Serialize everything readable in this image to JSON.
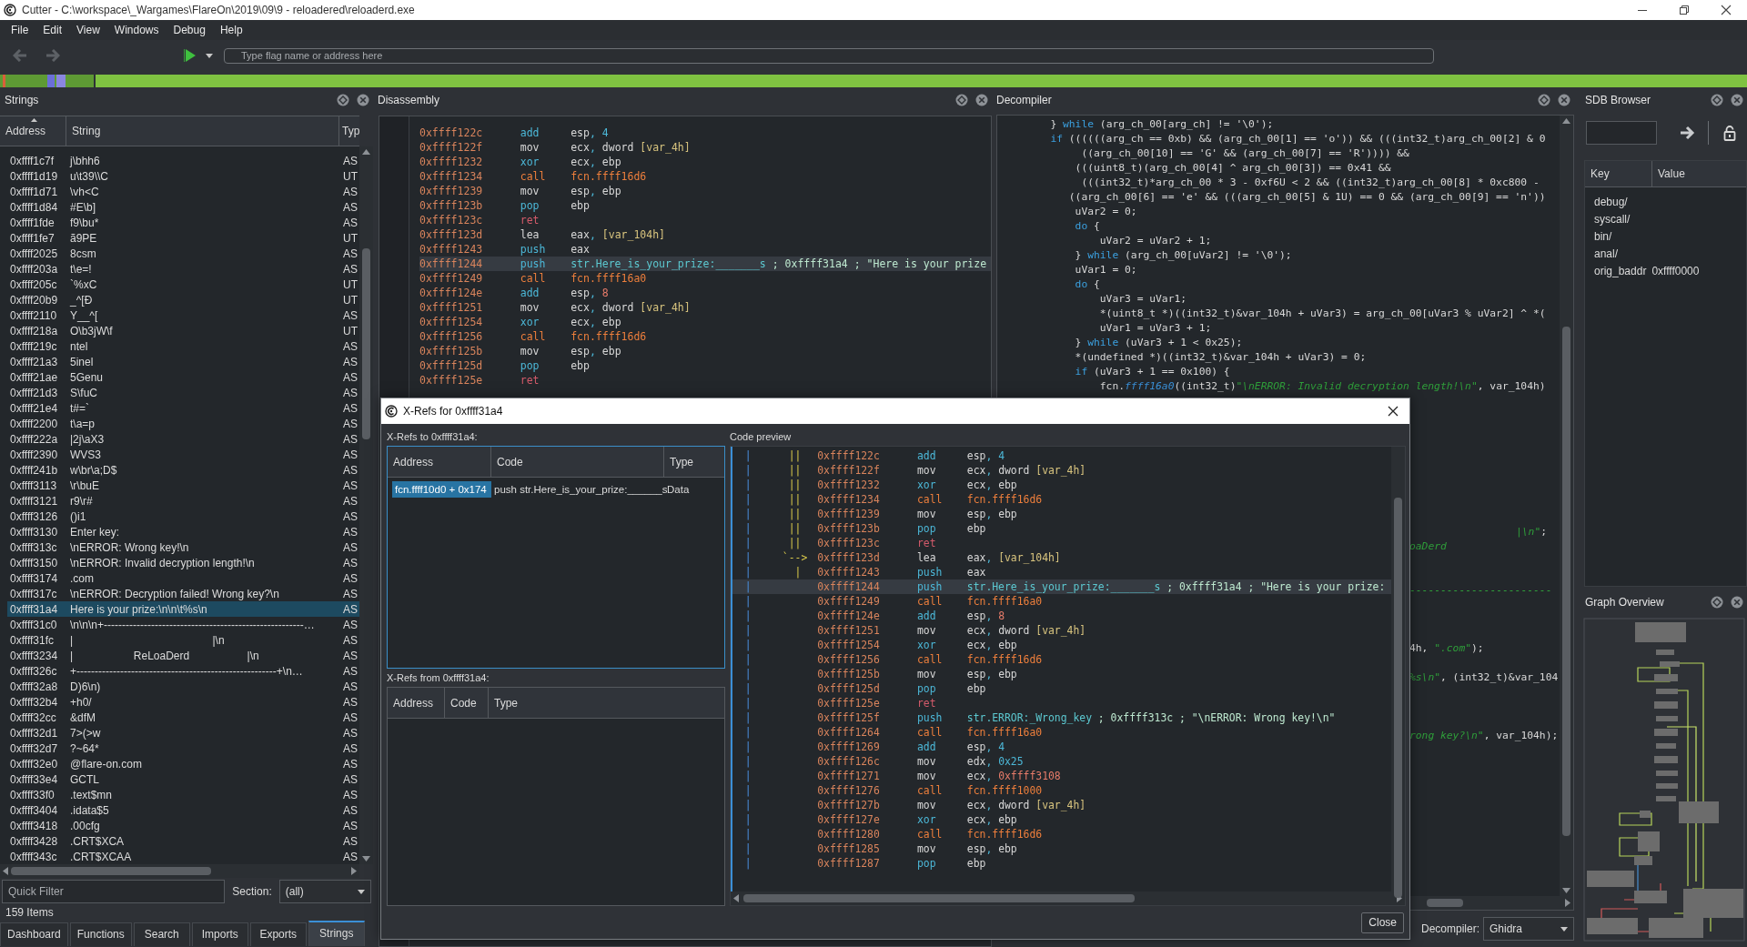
{
  "window": {
    "title": "Cutter - C:\\workspace\\_Wargames\\FlareOn\\2019\\09\\9 - reloadered\\reloaderd.exe"
  },
  "menu": [
    "File",
    "Edit",
    "View",
    "Windows",
    "Debug",
    "Help"
  ],
  "toolbar": {
    "search": {
      "placeholder": "Type flag name or address here"
    }
  },
  "strings_panel": {
    "title": "Strings",
    "columns": [
      "Address",
      "String",
      "Typ"
    ],
    "rows": [
      {
        "address": "0xffff1c7f",
        "string": "j\\bhh6",
        "type": "AS",
        "selected": false
      },
      {
        "address": "0xffff1d19",
        "string": "u\\t39\\\\C",
        "type": "UT",
        "selected": false
      },
      {
        "address": "0xffff1d71",
        "string": "\\vh<C",
        "type": "AS",
        "selected": false
      },
      {
        "address": "0xffff1d84",
        "string": "#E\\b]",
        "type": "AS",
        "selected": false
      },
      {
        "address": "0xffff1fde",
        "string": "f9\\bu*",
        "type": "AS",
        "selected": false
      },
      {
        "address": "0xffff1fe7",
        "string": "ã9PE",
        "type": "UT",
        "selected": false
      },
      {
        "address": "0xffff2025",
        "string": "8csm",
        "type": "AS",
        "selected": false
      },
      {
        "address": "0xffff203a",
        "string": "t\\e=!",
        "type": "AS",
        "selected": false
      },
      {
        "address": "0xffff205c",
        "string": "`%xC",
        "type": "UT",
        "selected": false
      },
      {
        "address": "0xffff20b9",
        "string": "_^[Ð",
        "type": "UT",
        "selected": false
      },
      {
        "address": "0xffff2110",
        "string": "Y__^[",
        "type": "AS",
        "selected": false
      },
      {
        "address": "0xffff218a",
        "string": "O\\b3jW\\f",
        "type": "UT",
        "selected": false
      },
      {
        "address": "0xffff219c",
        "string": "ntel",
        "type": "AS",
        "selected": false
      },
      {
        "address": "0xffff21a3",
        "string": "5inel",
        "type": "AS",
        "selected": false
      },
      {
        "address": "0xffff21ae",
        "string": "5Genu",
        "type": "AS",
        "selected": false
      },
      {
        "address": "0xffff21d3",
        "string": "S\\fuC",
        "type": "AS",
        "selected": false
      },
      {
        "address": "0xffff21e4",
        "string": "t#=`",
        "type": "AS",
        "selected": false
      },
      {
        "address": "0xffff2200",
        "string": "t\\a=p",
        "type": "AS",
        "selected": false
      },
      {
        "address": "0xffff222a",
        "string": "|2j\\aX3",
        "type": "AS",
        "selected": false
      },
      {
        "address": "0xffff2390",
        "string": "WVS3",
        "type": "AS",
        "selected": false
      },
      {
        "address": "0xffff241b",
        "string": "w\\br\\a;D$",
        "type": "AS",
        "selected": false
      },
      {
        "address": "0xffff3113",
        "string": "\\r\\buE",
        "type": "AS",
        "selected": false
      },
      {
        "address": "0xffff3121",
        "string": "r9\\r#",
        "type": "AS",
        "selected": false
      },
      {
        "address": "0xffff3126",
        "string": "()i1",
        "type": "AS",
        "selected": false
      },
      {
        "address": "0xffff3130",
        "string": "Enter key:",
        "type": "AS",
        "selected": false
      },
      {
        "address": "0xffff313c",
        "string": "\\nERROR: Wrong key!\\n",
        "type": "AS",
        "selected": false
      },
      {
        "address": "0xffff3150",
        "string": "\\nERROR: Invalid decryption length!\\n",
        "type": "AS",
        "selected": false
      },
      {
        "address": "0xffff3174",
        "string": ".com",
        "type": "AS",
        "selected": false
      },
      {
        "address": "0xffff317c",
        "string": "\\nERROR: Decryption failed! Wrong key?\\n",
        "type": "AS",
        "selected": false
      },
      {
        "address": "0xffff31a4",
        "string": "Here is your prize:\\n\\n\\t%s\\n",
        "type": "AS",
        "selected": true
      },
      {
        "address": "0xffff31c0",
        "string": "\\n\\n\\n+-------------------------------------------------------…",
        "type": "AS",
        "selected": false
      },
      {
        "address": "0xffff31fc",
        "string": "|                                              |\\n",
        "type": "AS",
        "selected": false
      },
      {
        "address": "0xffff3234",
        "string": "|                    ReLoaDerd                   |\\n",
        "type": "AS",
        "selected": false
      },
      {
        "address": "0xffff326c",
        "string": "+-------------------------------------------------------+\\n…",
        "type": "AS",
        "selected": false
      },
      {
        "address": "0xffff32a8",
        "string": "D)6\\n)",
        "type": "AS",
        "selected": false
      },
      {
        "address": "0xffff32b4",
        "string": "+h0/",
        "type": "AS",
        "selected": false
      },
      {
        "address": "0xffff32cc",
        "string": "&dfM",
        "type": "AS",
        "selected": false
      },
      {
        "address": "0xffff32d1",
        "string": "7>(>w",
        "type": "AS",
        "selected": false
      },
      {
        "address": "0xffff32d7",
        "string": "?~64*",
        "type": "AS",
        "selected": false
      },
      {
        "address": "0xffff32e0",
        "string": "@flare-on.com",
        "type": "AS",
        "selected": false
      },
      {
        "address": "0xffff33e4",
        "string": "GCTL",
        "type": "AS",
        "selected": false
      },
      {
        "address": "0xffff33f0",
        "string": ".text$mn",
        "type": "AS",
        "selected": false
      },
      {
        "address": "0xffff3404",
        "string": ".idata$5",
        "type": "AS",
        "selected": false
      },
      {
        "address": "0xffff3418",
        "string": ".00cfg",
        "type": "AS",
        "selected": false
      },
      {
        "address": "0xffff3428",
        "string": ".CRT$XCA",
        "type": "AS",
        "selected": false
      },
      {
        "address": "0xffff343c",
        "string": ".CRT$XCAA",
        "type": "AS",
        "selected": false
      }
    ],
    "filter": {
      "placeholder": "Quick Filter"
    },
    "section_label": "Section:",
    "section_value": "(all)",
    "count": "159 Items"
  },
  "bottom_tabs": [
    {
      "label": "Dashboard",
      "selected": false
    },
    {
      "label": "Functions",
      "selected": false
    },
    {
      "label": "Search",
      "selected": false
    },
    {
      "label": "Imports",
      "selected": false
    },
    {
      "label": "Exports",
      "selected": false
    },
    {
      "label": "Strings",
      "selected": true
    }
  ],
  "disassembly": {
    "title": "Disassembly",
    "rows": [
      {
        "address": "0xffff122c",
        "mnemonic": "add",
        "kind": "arith",
        "operands": [
          {
            "text": "esp",
            "kind": "reg"
          },
          {
            "text": ", ",
            "kind": "punct"
          },
          {
            "text": "4",
            "kind": "num"
          }
        ],
        "selected": false
      },
      {
        "address": "0xffff122f",
        "mnemonic": "mov",
        "kind": "move",
        "operands": [
          {
            "text": "ecx",
            "kind": "reg"
          },
          {
            "text": ", ",
            "kind": "punct"
          },
          {
            "text": "dword ",
            "kind": "reg"
          },
          {
            "text": "[var_4h]",
            "kind": "var"
          }
        ],
        "selected": false
      },
      {
        "address": "0xffff1232",
        "mnemonic": "xor",
        "kind": "arith",
        "operands": [
          {
            "text": "ecx",
            "kind": "reg"
          },
          {
            "text": ", ",
            "kind": "punct"
          },
          {
            "text": "ebp",
            "kind": "reg"
          }
        ],
        "selected": false
      },
      {
        "address": "0xffff1234",
        "mnemonic": "call",
        "kind": "call",
        "operands": [
          {
            "text": "fcn.ffff16d6",
            "kind": "fcn"
          }
        ],
        "selected": false
      },
      {
        "address": "0xffff1239",
        "mnemonic": "mov",
        "kind": "move",
        "operands": [
          {
            "text": "esp",
            "kind": "reg"
          },
          {
            "text": ", ",
            "kind": "punct"
          },
          {
            "text": "ebp",
            "kind": "reg"
          }
        ],
        "selected": false
      },
      {
        "address": "0xffff123b",
        "mnemonic": "pop",
        "kind": "arith",
        "operands": [
          {
            "text": "ebp",
            "kind": "reg"
          }
        ],
        "selected": false
      },
      {
        "address": "0xffff123c",
        "mnemonic": "ret",
        "kind": "ret",
        "operands": [],
        "selected": false
      },
      {
        "address": "0xffff123d",
        "mnemonic": "lea",
        "kind": "move",
        "operands": [
          {
            "text": "eax",
            "kind": "reg"
          },
          {
            "text": ", ",
            "kind": "punct"
          },
          {
            "text": "[var_104h]",
            "kind": "var"
          }
        ],
        "selected": false
      },
      {
        "address": "0xffff1243",
        "mnemonic": "push",
        "kind": "arith",
        "operands": [
          {
            "text": "eax",
            "kind": "reg"
          }
        ],
        "selected": false
      },
      {
        "address": "0xffff1244",
        "mnemonic": "push",
        "kind": "arith",
        "operands": [
          {
            "text": "str.Here_is_your_prize:_______s",
            "kind": "str"
          },
          {
            "text": " ; 0xffff31a4 ; \"Here is your prize",
            "kind": "comment"
          }
        ],
        "selected": true
      },
      {
        "address": "0xffff1249",
        "mnemonic": "call",
        "kind": "call",
        "operands": [
          {
            "text": "fcn.ffff16a0",
            "kind": "fcn"
          }
        ],
        "selected": false
      },
      {
        "address": "0xffff124e",
        "mnemonic": "add",
        "kind": "arith",
        "operands": [
          {
            "text": "esp",
            "kind": "reg"
          },
          {
            "text": ", ",
            "kind": "punct"
          },
          {
            "text": "8",
            "kind": "numalt"
          }
        ],
        "selected": false
      },
      {
        "address": "0xffff1251",
        "mnemonic": "mov",
        "kind": "move",
        "operands": [
          {
            "text": "ecx",
            "kind": "reg"
          },
          {
            "text": ", ",
            "kind": "punct"
          },
          {
            "text": "dword ",
            "kind": "reg"
          },
          {
            "text": "[var_4h]",
            "kind": "var"
          }
        ],
        "selected": false
      },
      {
        "address": "0xffff1254",
        "mnemonic": "xor",
        "kind": "arith",
        "operands": [
          {
            "text": "ecx",
            "kind": "reg"
          },
          {
            "text": ", ",
            "kind": "punct"
          },
          {
            "text": "ebp",
            "kind": "reg"
          }
        ],
        "selected": false
      },
      {
        "address": "0xffff1256",
        "mnemonic": "call",
        "kind": "call",
        "operands": [
          {
            "text": "fcn.ffff16d6",
            "kind": "fcn"
          }
        ],
        "selected": false
      },
      {
        "address": "0xffff125b",
        "mnemonic": "mov",
        "kind": "move",
        "operands": [
          {
            "text": "esp",
            "kind": "reg"
          },
          {
            "text": ", ",
            "kind": "punct"
          },
          {
            "text": "ebp",
            "kind": "reg"
          }
        ],
        "selected": false
      },
      {
        "address": "0xffff125d",
        "mnemonic": "pop",
        "kind": "arith",
        "operands": [
          {
            "text": "ebp",
            "kind": "reg"
          }
        ],
        "selected": false
      },
      {
        "address": "0xffff125e",
        "mnemonic": "ret",
        "kind": "ret",
        "operands": [],
        "selected": false
      }
    ]
  },
  "decompiler": {
    "title": "Decompiler",
    "lines": [
      [
        {
          "text": "        } ",
          "kind": "plain"
        },
        {
          "text": "while",
          "kind": "kw"
        },
        {
          "text": " (arg_ch_00[arg_ch] != '\\0');",
          "kind": "plain"
        }
      ],
      [
        {
          "text": "        if",
          "kind": "kw"
        },
        {
          "text": " ((((((arg_ch == 0xb) && (arg_ch_00[1] == 'o')) && (((int32_t)arg_ch_00[2] & 0",
          "kind": "plain"
        }
      ],
      [
        {
          "text": "             ((arg_ch_00[10] == 'G' && (arg_ch_00[7] == 'R')))) &&",
          "kind": "plain"
        }
      ],
      [
        {
          "text": "            (((uint8_t)(arg_ch_00[4] ^ arg_ch_00[3]) == 0x41 &&",
          "kind": "plain"
        }
      ],
      [
        {
          "text": "             (((int32_t)*arg_ch_00 * 3 - 0xf6U < 2 && ((int32_t)arg_ch_00[8] * 0xc800 -",
          "kind": "plain"
        }
      ],
      [
        {
          "text": "           ((arg_ch_00[6] == 'e' && (((arg_ch_00[5] & 1U) == 0 && (arg_ch_00[9] == 'n'))",
          "kind": "plain"
        }
      ],
      [
        {
          "text": "            uVar2 = 0;",
          "kind": "plain"
        }
      ],
      [
        {
          "text": "            do",
          "kind": "kw"
        },
        {
          "text": " {",
          "kind": "plain"
        }
      ],
      [
        {
          "text": "                uVar2 = uVar2 + 1;",
          "kind": "plain"
        }
      ],
      [
        {
          "text": "            } ",
          "kind": "plain"
        },
        {
          "text": "while",
          "kind": "kw"
        },
        {
          "text": " (arg_ch_00[uVar2] != '\\0');",
          "kind": "plain"
        }
      ],
      [
        {
          "text": "            uVar1 = 0;",
          "kind": "plain"
        }
      ],
      [
        {
          "text": "            do",
          "kind": "kw"
        },
        {
          "text": " {",
          "kind": "plain"
        }
      ],
      [
        {
          "text": "                uVar3 = uVar1;",
          "kind": "plain"
        }
      ],
      [
        {
          "text": "                *(uint8_t *)((int32_t)&var_104h + uVar3) = arg_ch_00[uVar3 % uVar2] ^ *(",
          "kind": "plain"
        }
      ],
      [
        {
          "text": "                uVar1 = uVar3 + 1;",
          "kind": "plain"
        }
      ],
      [
        {
          "text": "            } ",
          "kind": "plain"
        },
        {
          "text": "while",
          "kind": "kw"
        },
        {
          "text": " (uVar3 + 1 < 0x25);",
          "kind": "plain"
        }
      ],
      [
        {
          "text": "            *(undefined *)((int32_t)&var_104h + uVar3) = 0;",
          "kind": "plain"
        }
      ],
      [
        {
          "text": "            if",
          "kind": "kw"
        },
        {
          "text": " (uVar3 + 1 == 0x100) {",
          "kind": "plain"
        }
      ],
      [
        {
          "text": "                fcn.",
          "kind": "plain"
        },
        {
          "text": "ffff16a0",
          "kind": "fn"
        },
        {
          "text": "((int32_t)",
          "kind": "plain"
        },
        {
          "text": "\"\\nERROR: Invalid decryption length!\\n\"",
          "kind": "str"
        },
        {
          "text": ", var_104h)",
          "kind": "plain"
        }
      ]
    ],
    "visible_fragments": [
      [
        {
          "text": "|\\n\"",
          "kind": "str"
        },
        {
          "text": ";",
          "kind": "plain"
        }
      ],
      [
        {
          "text": "oaDerd",
          "kind": "str"
        }
      ],
      [
        {
          "text": "-----------------------",
          "kind": "str"
        }
      ],
      [
        {
          "text": "4h, ",
          "kind": "plain"
        },
        {
          "text": "\".com\"",
          "kind": "str"
        },
        {
          "text": ");",
          "kind": "plain"
        }
      ],
      [
        {
          "text": "%s\\n\"",
          "kind": "str"
        },
        {
          "text": ", (int32_t)&var_104",
          "kind": "plain"
        }
      ],
      [
        {
          "text": "rong key?\\n\"",
          "kind": "str"
        },
        {
          "text": ", var_104h);",
          "kind": "plain"
        }
      ]
    ],
    "engine_label": "Decompiler:",
    "engine": "Ghidra"
  },
  "sdb_browser": {
    "title": "SDB Browser",
    "columns": [
      "Key",
      "Value"
    ],
    "rows": [
      {
        "key": "debug/"
      },
      {
        "key": "syscall/"
      },
      {
        "key": "bin/"
      },
      {
        "key": "anal/"
      },
      {
        "key": "orig_baddr",
        "value": "0xffff0000"
      }
    ]
  },
  "graph_overview": {
    "title": "Graph Overview"
  },
  "xrefs_dialog": {
    "title": "X-Refs for 0xffff31a4",
    "to_label": "X-Refs to 0xffff31a4:",
    "to_columns": [
      "Address",
      "Code",
      "Type"
    ],
    "to_rows": [
      {
        "address": "fcn.ffff10d0 + 0x174",
        "code": "push str.Here_is_your_prize:______s",
        "type": "Data",
        "selected": true
      }
    ],
    "from_label": "X-Refs from 0xffff31a4:",
    "from_columns": [
      "Address",
      "Code",
      "Type"
    ],
    "preview_label": "Code preview",
    "preview_rows": [
      {
        "rail": "|",
        "branch": "      ||",
        "address": "0xffff122c",
        "mnemonic": "add",
        "kind": "arith",
        "operands": [
          {
            "text": "esp",
            "kind": "reg"
          },
          {
            "text": ", ",
            "kind": "punct"
          },
          {
            "text": "4",
            "kind": "num"
          }
        ],
        "selected": false
      },
      {
        "rail": "|",
        "branch": "      ||",
        "address": "0xffff122f",
        "mnemonic": "mov",
        "kind": "move",
        "operands": [
          {
            "text": "ecx",
            "kind": "reg"
          },
          {
            "text": ", ",
            "kind": "punct"
          },
          {
            "text": "dword ",
            "kind": "reg"
          },
          {
            "text": "[var_4h]",
            "kind": "var"
          }
        ],
        "selected": false
      },
      {
        "rail": "|",
        "branch": "      ||",
        "address": "0xffff1232",
        "mnemonic": "xor",
        "kind": "arith",
        "operands": [
          {
            "text": "ecx",
            "kind": "reg"
          },
          {
            "text": ", ",
            "kind": "punct"
          },
          {
            "text": "ebp",
            "kind": "reg"
          }
        ],
        "selected": false
      },
      {
        "rail": "|",
        "branch": "      ||",
        "address": "0xffff1234",
        "mnemonic": "call",
        "kind": "call",
        "operands": [
          {
            "text": "fcn.ffff16d6",
            "kind": "fcn"
          }
        ],
        "selected": false
      },
      {
        "rail": "|",
        "branch": "      ||",
        "address": "0xffff1239",
        "mnemonic": "mov",
        "kind": "move",
        "operands": [
          {
            "text": "esp",
            "kind": "reg"
          },
          {
            "text": ", ",
            "kind": "punct"
          },
          {
            "text": "ebp",
            "kind": "reg"
          }
        ],
        "selected": false
      },
      {
        "rail": "|",
        "branch": "      ||",
        "address": "0xffff123b",
        "mnemonic": "pop",
        "kind": "arith",
        "operands": [
          {
            "text": "ebp",
            "kind": "reg"
          }
        ],
        "selected": false
      },
      {
        "rail": "|",
        "branch": "      ||",
        "address": "0xffff123c",
        "mnemonic": "ret",
        "kind": "ret",
        "operands": [],
        "selected": false
      },
      {
        "rail": "|",
        "branch": "     `-->",
        "address": "0xffff123d",
        "mnemonic": "lea",
        "kind": "move",
        "operands": [
          {
            "text": "eax",
            "kind": "reg"
          },
          {
            "text": ", ",
            "kind": "punct"
          },
          {
            "text": "[var_104h]",
            "kind": "var"
          }
        ],
        "selected": false
      },
      {
        "rail": "|",
        "branch": "       |",
        "address": "0xffff1243",
        "mnemonic": "push",
        "kind": "arith",
        "operands": [
          {
            "text": "eax",
            "kind": "reg"
          }
        ],
        "selected": false
      },
      {
        "rail": "|",
        "address": "0xffff1244",
        "mnemonic": "push",
        "kind": "arith",
        "operands": [
          {
            "text": "str.Here_is_your_prize:_______s",
            "kind": "str"
          },
          {
            "text": " ; 0xffff31a4 ; \"Here is your prize:",
            "kind": "comment"
          }
        ],
        "selected": true
      },
      {
        "rail": "|",
        "address": "0xffff1249",
        "mnemonic": "call",
        "kind": "call",
        "operands": [
          {
            "text": "fcn.ffff16a0",
            "kind": "fcn"
          }
        ],
        "selected": false
      },
      {
        "rail": "|",
        "address": "0xffff124e",
        "mnemonic": "add",
        "kind": "arith",
        "operands": [
          {
            "text": "esp",
            "kind": "reg"
          },
          {
            "text": ", ",
            "kind": "punct"
          },
          {
            "text": "8",
            "kind": "numalt"
          }
        ],
        "selected": false
      },
      {
        "rail": "|",
        "address": "0xffff1251",
        "mnemonic": "mov",
        "kind": "move",
        "operands": [
          {
            "text": "ecx",
            "kind": "reg"
          },
          {
            "text": ", ",
            "kind": "punct"
          },
          {
            "text": "dword ",
            "kind": "reg"
          },
          {
            "text": "[var_4h]",
            "kind": "var"
          }
        ],
        "selected": false
      },
      {
        "rail": "|",
        "address": "0xffff1254",
        "mnemonic": "xor",
        "kind": "arith",
        "operands": [
          {
            "text": "ecx",
            "kind": "reg"
          },
          {
            "text": ", ",
            "kind": "punct"
          },
          {
            "text": "ebp",
            "kind": "reg"
          }
        ],
        "selected": false
      },
      {
        "rail": "|",
        "address": "0xffff1256",
        "mnemonic": "call",
        "kind": "call",
        "operands": [
          {
            "text": "fcn.ffff16d6",
            "kind": "fcn"
          }
        ],
        "selected": false
      },
      {
        "rail": "|",
        "address": "0xffff125b",
        "mnemonic": "mov",
        "kind": "move",
        "operands": [
          {
            "text": "esp",
            "kind": "reg"
          },
          {
            "text": ", ",
            "kind": "punct"
          },
          {
            "text": "ebp",
            "kind": "reg"
          }
        ],
        "selected": false
      },
      {
        "rail": "|",
        "address": "0xffff125d",
        "mnemonic": "pop",
        "kind": "arith",
        "operands": [
          {
            "text": "ebp",
            "kind": "reg"
          }
        ],
        "selected": false
      },
      {
        "rail": "|",
        "address": "0xffff125e",
        "mnemonic": "ret",
        "kind": "ret",
        "operands": [],
        "selected": false
      },
      {
        "rail": "|",
        "address": "0xffff125f",
        "mnemonic": "push",
        "kind": "arith",
        "operands": [
          {
            "text": "str.ERROR:_Wrong_key",
            "kind": "str"
          },
          {
            "text": " ; 0xffff313c ; \"\\nERROR: Wrong key!\\n\"",
            "kind": "comment"
          }
        ],
        "selected": false
      },
      {
        "rail": "|",
        "address": "0xffff1264",
        "mnemonic": "call",
        "kind": "call",
        "operands": [
          {
            "text": "fcn.ffff16a0",
            "kind": "fcn"
          }
        ],
        "selected": false
      },
      {
        "rail": "|",
        "address": "0xffff1269",
        "mnemonic": "add",
        "kind": "arith",
        "operands": [
          {
            "text": "esp",
            "kind": "reg"
          },
          {
            "text": ", ",
            "kind": "punct"
          },
          {
            "text": "4",
            "kind": "num"
          }
        ],
        "selected": false
      },
      {
        "rail": "|",
        "address": "0xffff126c",
        "mnemonic": "mov",
        "kind": "move",
        "operands": [
          {
            "text": "edx",
            "kind": "reg"
          },
          {
            "text": ", ",
            "kind": "punct"
          },
          {
            "text": "0x25",
            "kind": "num"
          }
        ],
        "selected": false
      },
      {
        "rail": "|",
        "address": "0xffff1271",
        "mnemonic": "mov",
        "kind": "move",
        "operands": [
          {
            "text": "ecx",
            "kind": "reg"
          },
          {
            "text": ", ",
            "kind": "punct"
          },
          {
            "text": "0xffff3108",
            "kind": "numalt"
          }
        ],
        "selected": false
      },
      {
        "rail": "|",
        "address": "0xffff1276",
        "mnemonic": "call",
        "kind": "call",
        "operands": [
          {
            "text": "fcn.ffff1000",
            "kind": "fcn"
          }
        ],
        "selected": false
      },
      {
        "rail": "|",
        "address": "0xffff127b",
        "mnemonic": "mov",
        "kind": "move",
        "operands": [
          {
            "text": "ecx",
            "kind": "reg"
          },
          {
            "text": ", ",
            "kind": "punct"
          },
          {
            "text": "dword ",
            "kind": "reg"
          },
          {
            "text": "[var_4h]",
            "kind": "var"
          }
        ],
        "selected": false
      },
      {
        "rail": "|",
        "address": "0xffff127e",
        "mnemonic": "xor",
        "kind": "arith",
        "operands": [
          {
            "text": "ecx",
            "kind": "reg"
          },
          {
            "text": ", ",
            "kind": "punct"
          },
          {
            "text": "ebp",
            "kind": "reg"
          }
        ],
        "selected": false
      },
      {
        "rail": "|",
        "address": "0xffff1280",
        "mnemonic": "call",
        "kind": "call",
        "operands": [
          {
            "text": "fcn.ffff16d6",
            "kind": "fcn"
          }
        ],
        "selected": false
      },
      {
        "rail": "|",
        "address": "0xffff1285",
        "mnemonic": "mov",
        "kind": "move",
        "operands": [
          {
            "text": "esp",
            "kind": "reg"
          },
          {
            "text": ", ",
            "kind": "punct"
          },
          {
            "text": "ebp",
            "kind": "reg"
          }
        ],
        "selected": false
      },
      {
        "rail": "|",
        "address": "0xffff1287",
        "mnemonic": "pop",
        "kind": "arith",
        "operands": [
          {
            "text": "ebp",
            "kind": "reg"
          }
        ],
        "selected": false
      }
    ],
    "close_button": "Close"
  }
}
